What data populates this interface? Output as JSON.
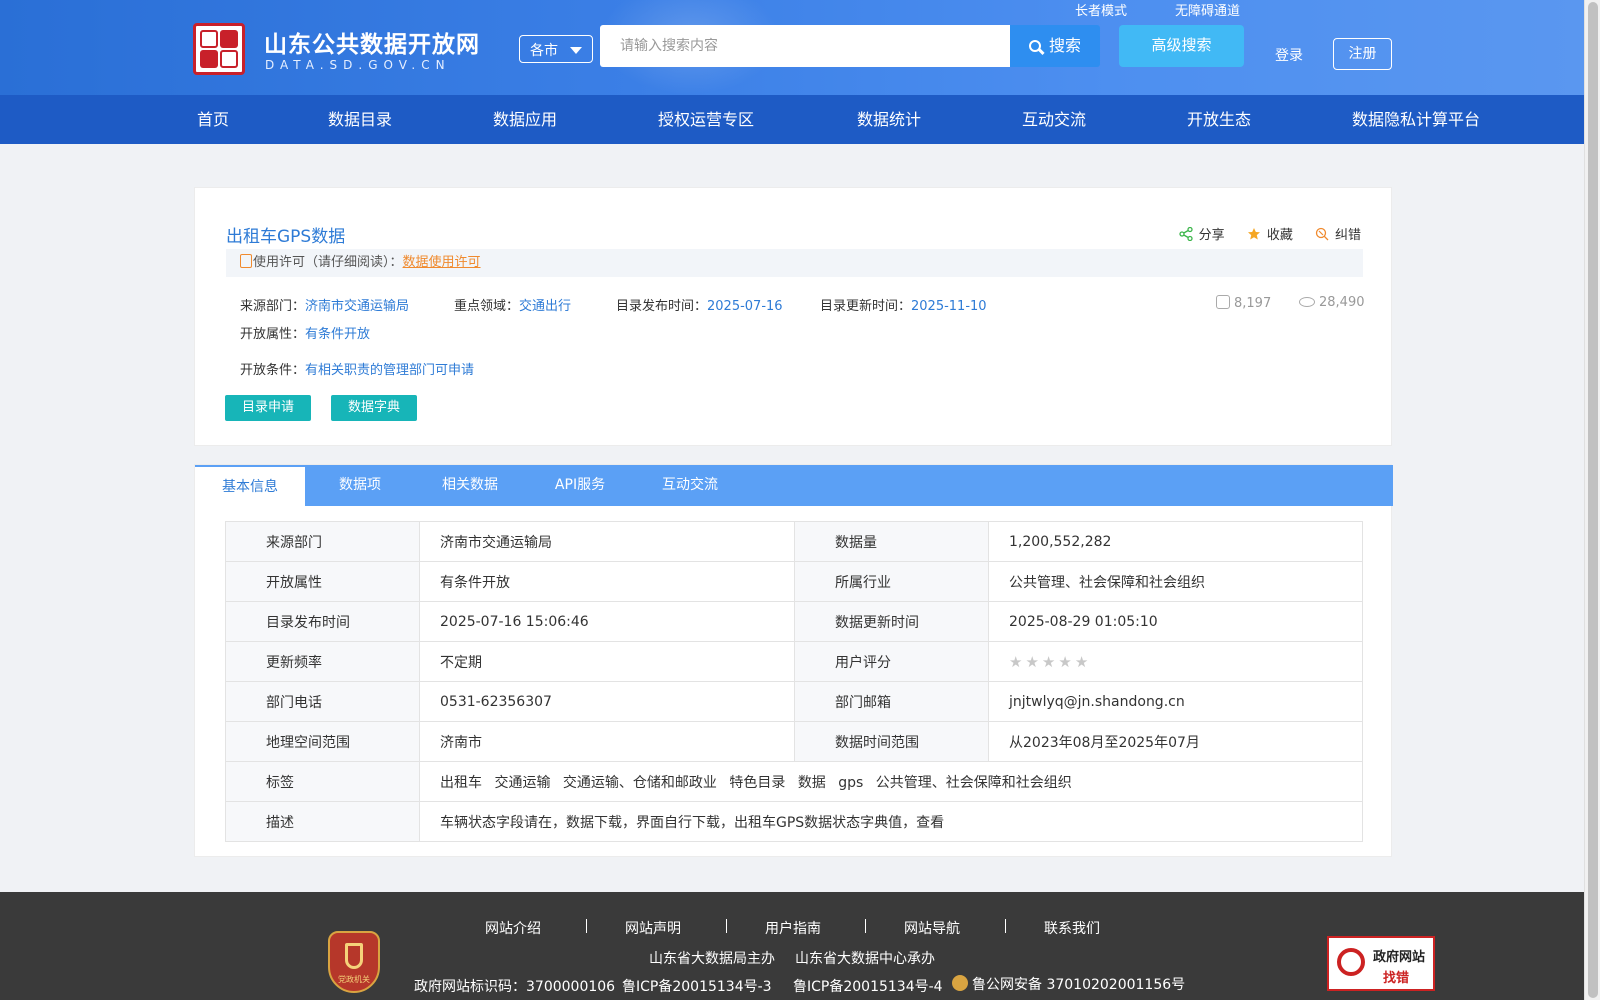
{
  "header": {
    "site_title": "山东公共数据开放网",
    "site_sub": "DATA.SD.GOV.CN",
    "city_select": "各市",
    "search_placeholder": "请输入搜索内容",
    "search_button": "搜索",
    "advanced_search": "高级搜索",
    "elder_mode": "长者模式",
    "accessible": "无障碍通道",
    "login": "登录",
    "register": "注册"
  },
  "nav": [
    "首页",
    "数据目录",
    "数据应用",
    "授权运营专区",
    "数据统计",
    "互动交流",
    "开放生态",
    "数据隐私计算平台"
  ],
  "dataset": {
    "title": "出租车GPS数据",
    "actions": {
      "share": "分享",
      "favorite": "收藏",
      "correct": "纠错"
    },
    "license_label": "使用许可（请仔细阅读）：",
    "license_link": "数据使用许可",
    "source_label": "来源部门：",
    "source_value": "济南市交通运输局",
    "field_label": "重点领域：",
    "field_value": "交通出行",
    "publish_label": "目录发布时间：",
    "publish_value": "2025-07-16",
    "update_label": "目录更新时间：",
    "update_value": "2025-11-10",
    "downloads": "8,197",
    "views": "28,490",
    "open_attr_label": "开放属性：",
    "open_attr_value": "有条件开放",
    "open_cond_label": "开放条件：",
    "open_cond_value": "有相关职责的管理部门可申请",
    "btn_apply": "目录申请",
    "btn_dict": "数据字典"
  },
  "tabs": [
    "基本信息",
    "数据项",
    "相关数据",
    "API服务",
    "互动交流"
  ],
  "info": {
    "rows": [
      {
        "k1": "来源部门",
        "v1": "济南市交通运输局",
        "k2": "数据量",
        "v2": "1,200,552,282"
      },
      {
        "k1": "开放属性",
        "v1": "有条件开放",
        "k2": "所属行业",
        "v2": "公共管理、社会保障和社会组织"
      },
      {
        "k1": "目录发布时间",
        "v1": "2025-07-16 15:06:46",
        "k2": "数据更新时间",
        "v2": "2025-08-29 01:05:10"
      },
      {
        "k1": "更新频率",
        "v1": "不定期",
        "k2": "用户评分",
        "v2": ""
      },
      {
        "k1": "部门电话",
        "v1": "0531-62356307",
        "k2": "部门邮箱",
        "v2": "jnjtwlyq@jn.shandong.cn"
      },
      {
        "k1": "地理空间范围",
        "v1": "济南市",
        "k2": "数据时间范围",
        "v2": "从2023年08月至2025年07月"
      }
    ],
    "rating": 0,
    "tags_label": "标签",
    "tags": [
      "出租车",
      "交通运输",
      "交通运输、仓储和邮政业",
      "特色目录",
      "数据",
      "gps",
      "公共管理、社会保障和社会组织"
    ],
    "desc_label": "描述",
    "desc": "车辆状态字段请在，数据下载，界面自行下载，出租车GPS数据状态字典值，查看"
  },
  "footer": {
    "links": [
      "网站介绍",
      "网站声明",
      "用户指南",
      "网站导航",
      "联系我们"
    ],
    "host": "山东省大数据局主办",
    "organizer": "山东省大数据中心承办",
    "site_id": "政府网站标识码：3700000106",
    "icp3": "鲁ICP备20015134号-3",
    "icp4": "鲁ICP备20015134号-4",
    "police": "鲁公网安备 37010202001156号",
    "party_badge": "党政机关",
    "gov_badge_1": "政府网站",
    "gov_badge_2": "找错"
  }
}
